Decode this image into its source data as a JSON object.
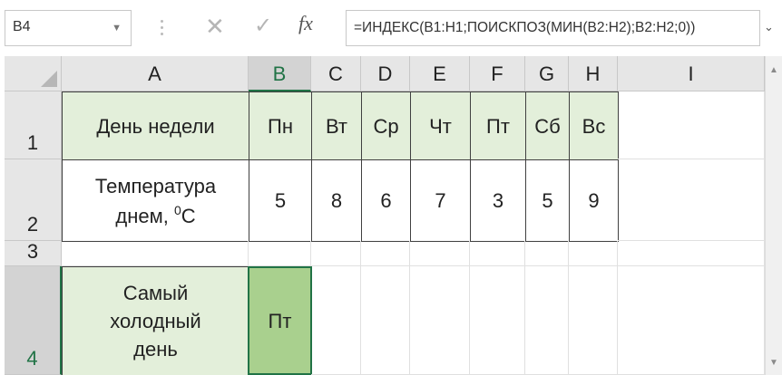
{
  "formula_bar": {
    "name_box": "B4",
    "name_box_arrow_icon": "chevron-down-icon",
    "cancel_icon": "✕",
    "enter_icon": "✓",
    "fx_label": "fx",
    "formula": "=ИНДЕКС(B1:H1;ПОИСКПОЗ(МИН(B2:H2);B2:H2;0))"
  },
  "columns": [
    "A",
    "B",
    "C",
    "D",
    "E",
    "F",
    "G",
    "H",
    "I"
  ],
  "rows": [
    "1",
    "2",
    "3",
    "4"
  ],
  "selected_column": "B",
  "selected_row": "4",
  "cells": {
    "A1": "День недели",
    "B1": "Пн",
    "C1": "Вт",
    "D1": "Ср",
    "E1": "Чт",
    "F1": "Пт",
    "G1": "Сб",
    "H1": "Вс",
    "A2_line1": "Температура",
    "A2_line2": "днем,",
    "A2_deg": "0",
    "A2_unit": "С",
    "B2": "5",
    "C2": "8",
    "D2": "6",
    "E2": "7",
    "F2": "3",
    "G2": "5",
    "H2": "9",
    "A4_line1": "Самый",
    "A4_line2": "холодный",
    "A4_line3": "день",
    "B4": "Пт"
  },
  "colors": {
    "header_fill": "#e3efda",
    "active_cell_fill": "#a9d08e",
    "selection_border": "#217346"
  }
}
